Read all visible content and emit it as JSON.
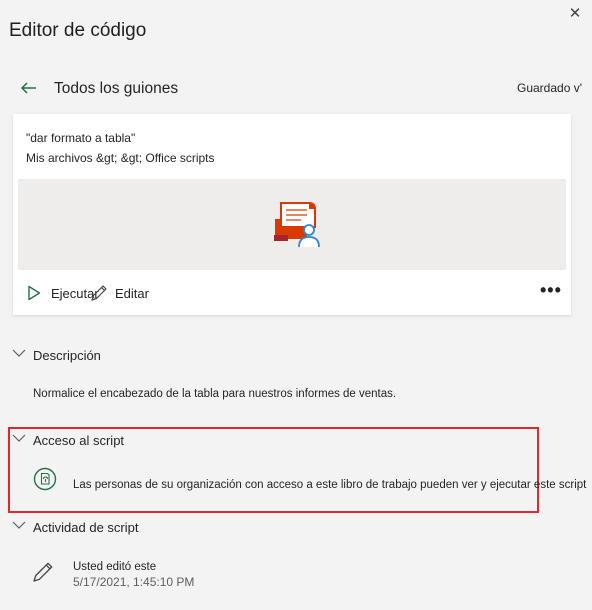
{
  "pane": {
    "title": "Editor de código",
    "close_icon": "close-icon"
  },
  "nav": {
    "back_label": "Todos los guiones",
    "saved_status": "Guardado v'"
  },
  "script_card": {
    "name": "\"dar formato a tabla\"",
    "path": "Mis archivos &gt; &gt; Office scripts",
    "actions": {
      "run_label": "Ejecutar",
      "edit_label": "Editar",
      "more_label": "•••"
    }
  },
  "sections": {
    "description": {
      "label": "Descripción",
      "text": "Normalice el encabezado de la tabla para nuestros informes de ventas."
    },
    "access": {
      "label": "Acceso al script",
      "text": "Las personas de su organización con acceso a este libro de trabajo pueden ver y ejecutar este script"
    },
    "activity": {
      "label": "Actividad de script",
      "entry_text": "Usted editó este",
      "entry_time": "5/17/2021, 1:45:10 PM"
    }
  },
  "colors": {
    "accent_green": "#217346",
    "highlight_red": "#e0282e",
    "office_red": "#d83b01",
    "person_blue": "#2b88d8"
  }
}
